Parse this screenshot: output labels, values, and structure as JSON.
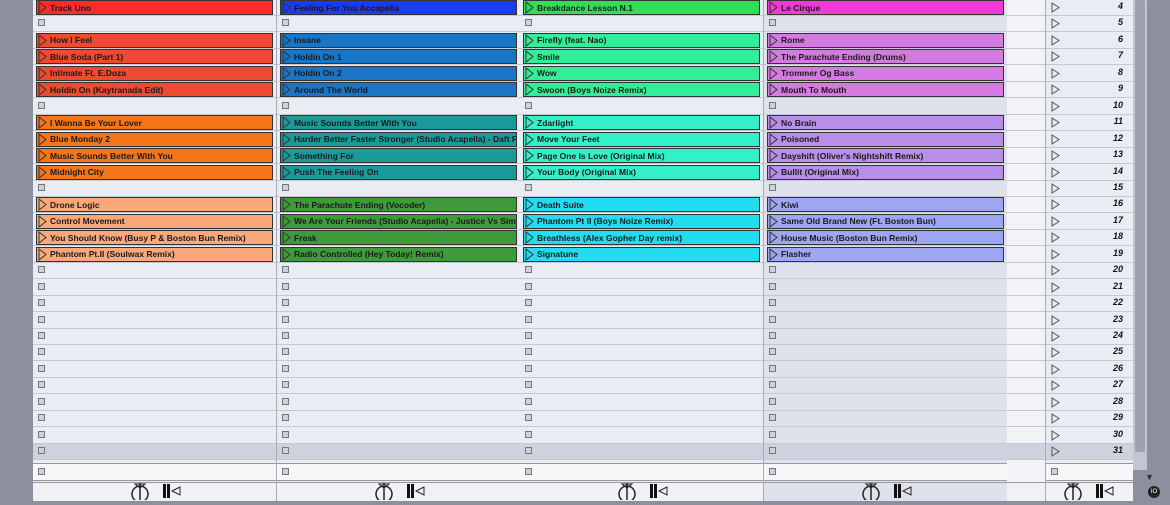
{
  "tracks": [
    {
      "name": "track-1",
      "clips": [
        {
          "row": 0,
          "label": "Track Uno",
          "color": "#ff2a2a"
        },
        {
          "row": 2,
          "label": "How I Feel",
          "color": "#ee4a30"
        },
        {
          "row": 3,
          "label": "Blue Soda (Part 1)",
          "color": "#ee4a30"
        },
        {
          "row": 4,
          "label": "Intimate Ft. E.Doza",
          "color": "#ee4a30"
        },
        {
          "row": 5,
          "label": "Holdin On (Kaytranada Edit)",
          "color": "#ee4a30"
        },
        {
          "row": 7,
          "label": "I Wanna Be Your Lover",
          "color": "#f4751a"
        },
        {
          "row": 8,
          "label": "Blue Monday 2",
          "color": "#f4751a"
        },
        {
          "row": 9,
          "label": "Music Sounds Better With You",
          "color": "#f4751a"
        },
        {
          "row": 10,
          "label": "Midnight City",
          "color": "#f4751a"
        },
        {
          "row": 12,
          "label": "Drone Logic",
          "color": "#f9a87a"
        },
        {
          "row": 13,
          "label": "Control Movement",
          "color": "#f9a87a"
        },
        {
          "row": 14,
          "label": "You Should Know (Busy P & Boston Bun Remix)",
          "color": "#f9a87a"
        },
        {
          "row": 15,
          "label": "Phantom Pt.II (Soulwax Remix)",
          "color": "#f9a87a"
        }
      ]
    },
    {
      "name": "track-2",
      "clips": [
        {
          "row": 0,
          "label": "Feeling For You Accapella",
          "color": "#1a3cf0"
        },
        {
          "row": 2,
          "label": "Insane",
          "color": "#1a76c4"
        },
        {
          "row": 3,
          "label": "Holdin On 1",
          "color": "#1a76c4"
        },
        {
          "row": 4,
          "label": "Holdin On 2",
          "color": "#1a76c4"
        },
        {
          "row": 5,
          "label": "Around The World",
          "color": "#1a76c4"
        },
        {
          "row": 7,
          "label": "Music Sounds Better With You",
          "color": "#1a9a9a"
        },
        {
          "row": 8,
          "label": "Harder Better Faster Stronger (Studio Acapella) - Daft Punk",
          "color": "#1a9a9a"
        },
        {
          "row": 9,
          "label": "Something For",
          "color": "#1a9a9a"
        },
        {
          "row": 10,
          "label": "Push The Feeling On",
          "color": "#1a9a9a"
        },
        {
          "row": 12,
          "label": "The Parachute Ending (Vocoder)",
          "color": "#3f9a3a"
        },
        {
          "row": 13,
          "label": "We Are Your Friends (Studio Acapella) - Justice Vs Simian",
          "color": "#3f9a3a"
        },
        {
          "row": 14,
          "label": "Freak",
          "color": "#3f9a3a"
        },
        {
          "row": 15,
          "label": "Radio Controlled (Hey Today! Remix)",
          "color": "#3f9a3a"
        }
      ]
    },
    {
      "name": "track-3",
      "clips": [
        {
          "row": 0,
          "label": "Breakdance Lesson N.1",
          "color": "#33dd55"
        },
        {
          "row": 2,
          "label": "Firefly (feat. Nao)",
          "color": "#33ee99"
        },
        {
          "row": 3,
          "label": "Smile",
          "color": "#33ee99"
        },
        {
          "row": 4,
          "label": "Wow",
          "color": "#33ee99"
        },
        {
          "row": 5,
          "label": "Swoon (Boys Noize Remix)",
          "color": "#33ee99"
        },
        {
          "row": 7,
          "label": "Zdarlight",
          "color": "#33f0c8"
        },
        {
          "row": 8,
          "label": "Move Your Feet",
          "color": "#33f0c8"
        },
        {
          "row": 9,
          "label": "Page One Is Love (Original Mix)",
          "color": "#33f0c8"
        },
        {
          "row": 10,
          "label": "Your Body (Original Mix)",
          "color": "#33f0c8"
        },
        {
          "row": 12,
          "label": "Death Suite",
          "color": "#22dcf0"
        },
        {
          "row": 13,
          "label": "Phantom Pt II (Boys Noize Remix)",
          "color": "#22dcf0"
        },
        {
          "row": 14,
          "label": "Breathless (Alex Gopher Day remix)",
          "color": "#22dcf0"
        },
        {
          "row": 15,
          "label": "Signatune",
          "color": "#22dcf0"
        }
      ]
    },
    {
      "name": "track-4",
      "clips": [
        {
          "row": 0,
          "label": "Le Cirque",
          "color": "#f03ad8"
        },
        {
          "row": 2,
          "label": "Rome",
          "color": "#d47ae0"
        },
        {
          "row": 3,
          "label": "The Parachute Ending (Drums)",
          "color": "#d47ae0"
        },
        {
          "row": 4,
          "label": "Trommer Og Bass",
          "color": "#d47ae0"
        },
        {
          "row": 5,
          "label": "Mouth To Mouth",
          "color": "#d47ae0"
        },
        {
          "row": 7,
          "label": "No Brain",
          "color": "#b98ee8"
        },
        {
          "row": 8,
          "label": "Poisoned",
          "color": "#b98ee8"
        },
        {
          "row": 9,
          "label": "Dayshift (Oliver's Nightshift Remix)",
          "color": "#b98ee8"
        },
        {
          "row": 10,
          "label": "Bullit (Original Mix)",
          "color": "#b98ee8"
        },
        {
          "row": 12,
          "label": "Kiwi",
          "color": "#9da6f0"
        },
        {
          "row": 13,
          "label": "Same Old Brand New (Ft. Boston Bun)",
          "color": "#9da6f0"
        },
        {
          "row": 14,
          "label": "House Music (Boston Bun Remix)",
          "color": "#9da6f0"
        },
        {
          "row": 15,
          "label": "Flasher",
          "color": "#9da6f0"
        }
      ]
    }
  ],
  "scenes": [
    "4",
    "5",
    "6",
    "7",
    "8",
    "9",
    "10",
    "11",
    "12",
    "13",
    "14",
    "15",
    "16",
    "17",
    "18",
    "19",
    "20",
    "21",
    "22",
    "23",
    "24",
    "25",
    "26",
    "27",
    "28",
    "29",
    "30",
    "31"
  ],
  "colors": {
    "highlight_row": "#ced2de",
    "stop_scene": "#d985e0"
  },
  "icons": {
    "play": "play-triangle-icon",
    "stop": "stop-square-icon",
    "mixer": "mixer-icon",
    "io": "io-icon"
  }
}
